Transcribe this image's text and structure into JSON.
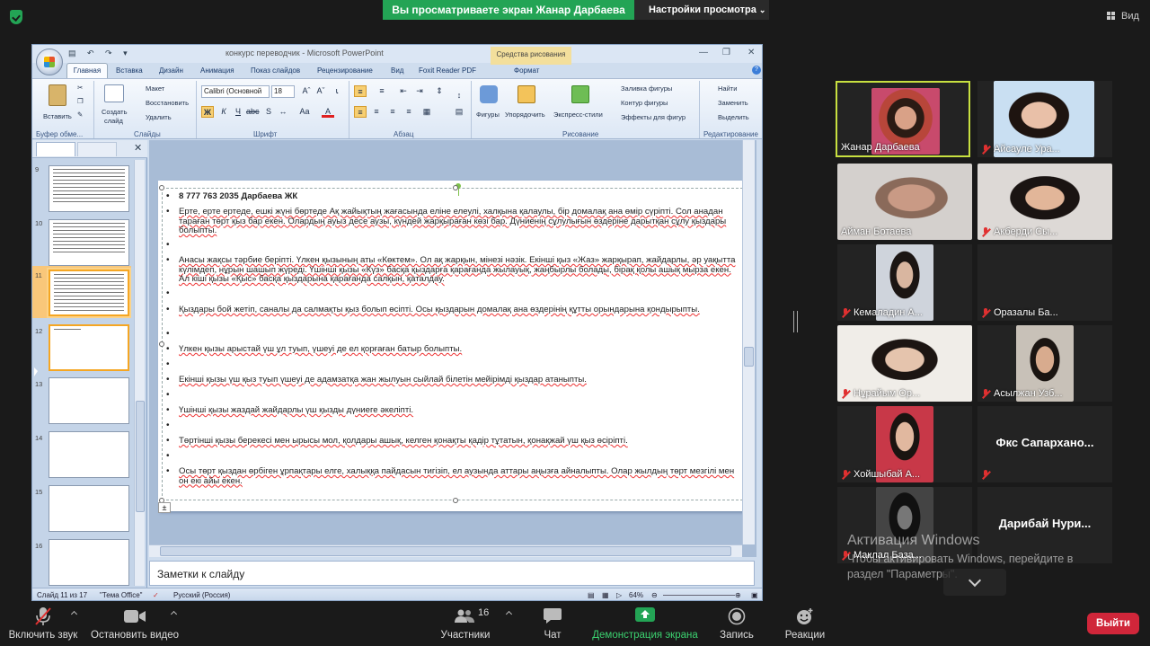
{
  "zoom_top": {
    "banner": "Вы просматриваете экран Жанар Дарбаева",
    "view_settings": "Настройки просмотра",
    "view": "Вид"
  },
  "ppt": {
    "title": "конкурс переводчик - Microsoft PowerPoint",
    "drawing_tools": "Средства рисования",
    "tabs": [
      "Главная",
      "Вставка",
      "Дизайн",
      "Анимация",
      "Показ слайдов",
      "Рецензирование",
      "Вид",
      "Foxit Reader PDF",
      "Формат"
    ],
    "ribbon": {
      "paste": "Вставить",
      "new_slide_1": "Создать",
      "new_slide_2": "слайд",
      "layout": "Макет",
      "reset": "Восстановить",
      "delete": "Удалить",
      "font_name": "Calibri (Основной",
      "font_size": "18",
      "shapes": "Фигуры",
      "arrange": "Упорядочить",
      "quick_styles": "Экспресс-стили",
      "shape_fill": "Заливка фигуры",
      "shape_outline": "Контур фигуры",
      "shape_effects": "Эффекты для фигур",
      "find": "Найти",
      "replace": "Заменить",
      "select": "Выделить",
      "groups": [
        "Буфер обме...",
        "Слайды",
        "Шрифт",
        "Абзац",
        "Рисование",
        "Редактирование"
      ]
    },
    "thumb_numbers": [
      "9",
      "10",
      "11",
      "12",
      "13",
      "14",
      "15",
      "16"
    ],
    "slide_lines": [
      {
        "parts": [
          "8 777 763 2035  Дарбаева  ЖК"
        ],
        "bold": true
      },
      {
        "parts": [
          "Ерте, ерте ертеде, ешкі жүні бөртеде Ақ жайықтың жағасында еліне елеулі, халқына қалаулы, бір домалақ ана өмір сүріпті. Сол анадан тараған төрт қыз бар екен. Олардың ауыз десе аузы, күндей жарқыраған көзі бар. Дүниенің сұлулығын өздеріне дарытқан сұлу қыздары болыпты."
        ]
      },
      {
        "parts": [
          ""
        ]
      },
      {
        "parts": [
          "Анасы жақсы тәрбие беріпті. Үлкен қызының аты «Көктем». Ол ақ жарқын, мінезі нәзік. Екінші қыз «Жаз» жарқырап, жайдарлы, әр уақытта күлімдеп, нұрын шашып жүреді. Үшінші қызы «Күз» басқа қыздарға қарағанда жылауық, жаңбырлы болады, бірақ қолы ашық мырза екен. Ал кіші қызы «Қыс» басқа қыздарына қарағанда салқын, қаталдау."
        ]
      },
      {
        "parts": [
          ""
        ]
      },
      {
        "parts": [
          "Қыздары бой жетіп,  саналы да салмақты қыз болып өсіпті. Осы қыздарын домалақ ана өздерінің құтты орындарына қондырыпты."
        ]
      },
      {
        "parts": [
          ""
        ]
      },
      {
        "parts": [
          "Үлкен қызы арыстай үш ұл туып, үшеуі де ел қорғаған батыр болыпты."
        ]
      },
      {
        "parts": [
          ""
        ]
      },
      {
        "parts": [
          "Екінші қызы үш қыз туып үшеуі де адамзатқа жан жылуын сыйлай білетін  мейірімді  қыздар атаныпты."
        ]
      },
      {
        "parts": [
          ""
        ]
      },
      {
        "parts": [
          "Үшінші қызы жаздай жайдарлы үш қызды дүниеге әкеліпті."
        ]
      },
      {
        "parts": [
          ""
        ]
      },
      {
        "parts": [
          "Төртінші қызы берекесі  мен ырысы мол, қолдары ашық, келген қонақты  қадір тұтатын, қонақжай үш қыз өсіріпті."
        ]
      },
      {
        "parts": [
          ""
        ]
      },
      {
        "parts": [
          "Осы төрт қыздан өрбіген ұрпақтары елге, халыққа пайдасын тигізіп, ел аузында аттары аңызға айналыпты.  Олар жылдың төрт мезгілі  мен  он екі айы екен."
        ]
      }
    ],
    "notes": "Заметки к слайду",
    "status": {
      "slide": "Слайд 11 из 17",
      "theme": "\"Тема Office\"",
      "lang": "Русский (Россия)",
      "zoom": "64%"
    }
  },
  "participants": [
    {
      "name": "Жанар Дарбаева",
      "muted": false,
      "active": true
    },
    {
      "name": "Айсауле Ура...",
      "muted": true
    },
    {
      "name": "Айман Ботаева",
      "muted": false
    },
    {
      "name": "Акберди Сы...",
      "muted": true
    },
    {
      "name": "Кемаладин А...",
      "muted": true
    },
    {
      "name": "Оразалы Ба...",
      "muted": true
    },
    {
      "name": "Нұрайым Ор...",
      "muted": true
    },
    {
      "name": "Асылжан Узб...",
      "muted": true
    },
    {
      "name": "Хойшыбай А...",
      "muted": true
    },
    {
      "name": "Фкс  Сапархано...",
      "muted": true,
      "no_video": true
    },
    {
      "name": "Маклал База...",
      "muted": true
    },
    {
      "name": "Дарибай  Нури...",
      "muted": false,
      "no_video": true
    }
  ],
  "activation": {
    "line1": "Активация Windows",
    "line2": "Чтобы активировать Windows, перейдите в",
    "line3": "раздел \"Параметры\"."
  },
  "toolbar": {
    "unmute": "Включить звук",
    "start_video": "Остановить видео",
    "participants": "Участники",
    "participants_count": "16",
    "chat": "Чат",
    "share": "Демонстрация экрана",
    "record": "Запись",
    "reactions": "Реакции",
    "leave": "Выйти"
  },
  "colors": {
    "zoom_green": "#23a455",
    "leave_red": "#d0263a",
    "active_speaker": "#c8e040"
  }
}
